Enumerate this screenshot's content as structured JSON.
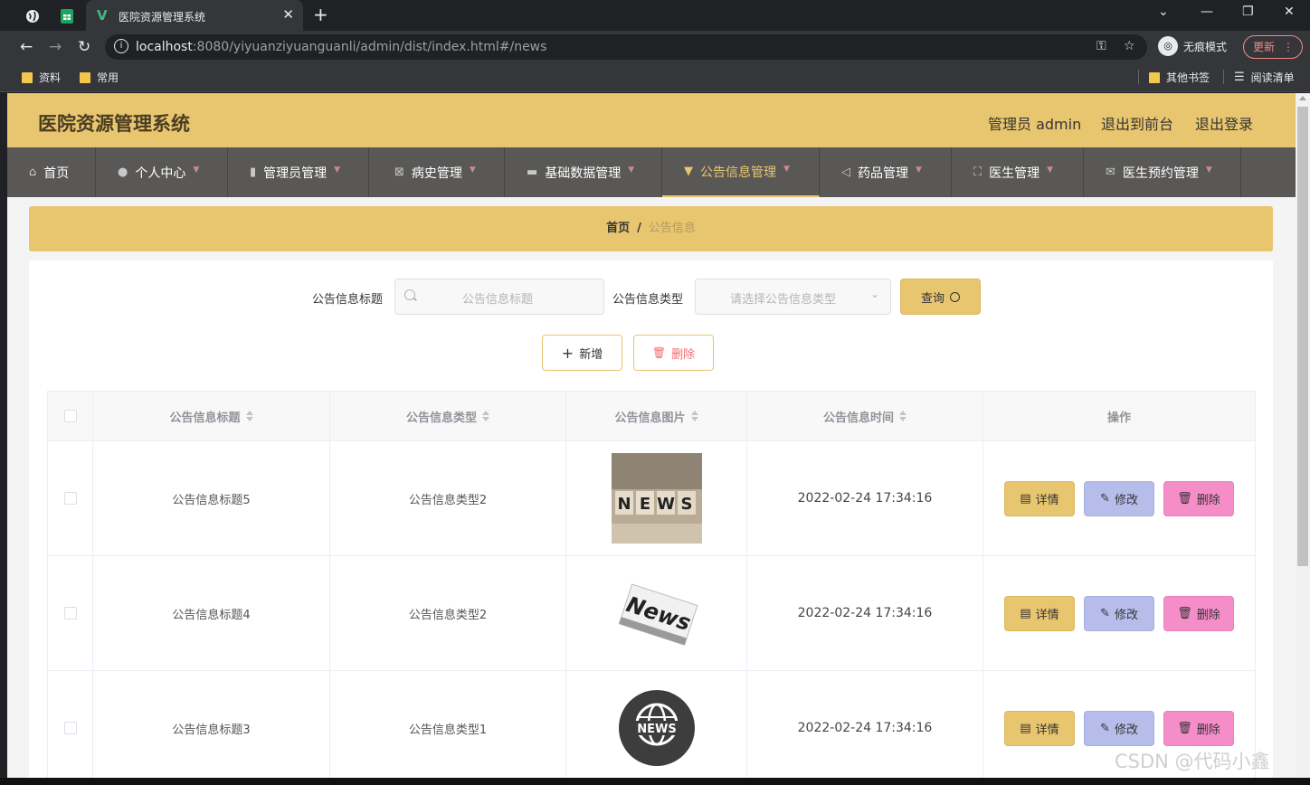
{
  "browser": {
    "tab_title": "医院资源管理系统",
    "url_host": "localhost",
    "url_rest": ":8080/yiyuanziyuanguanli/admin/dist/index.html#/news",
    "incognito_label": "无痕模式",
    "update_label": "更新",
    "bookmarks": [
      "资料",
      "常用"
    ],
    "other_bookmarks": "其他书签",
    "reading_list": "阅读清单"
  },
  "header": {
    "title": "医院资源管理系统",
    "user": "管理员 admin",
    "to_front": "退出到前台",
    "logout": "退出登录"
  },
  "menu": [
    {
      "label": "首页",
      "icon": "home-icon",
      "glyph": "⌂"
    },
    {
      "label": "个人中心",
      "icon": "user-icon",
      "glyph": "●"
    },
    {
      "label": "管理员管理",
      "icon": "book-icon",
      "glyph": "▮"
    },
    {
      "label": "病史管理",
      "icon": "clipboard-icon",
      "glyph": "⊠"
    },
    {
      "label": "基础数据管理",
      "icon": "monitor-icon",
      "glyph": "▬"
    },
    {
      "label": "公告信息管理",
      "icon": "brush-icon",
      "glyph": "▼"
    },
    {
      "label": "药品管理",
      "icon": "send-icon",
      "glyph": "◁"
    },
    {
      "label": "医生管理",
      "icon": "fullscreen-icon",
      "glyph": "⛶"
    },
    {
      "label": "医生预约管理",
      "icon": "mail-icon",
      "glyph": "✉"
    }
  ],
  "breadcrumb": {
    "home": "首页",
    "sep": "/",
    "current": "公告信息"
  },
  "search": {
    "title_label": "公告信息标题",
    "title_placeholder": "公告信息标题",
    "type_label": "公告信息类型",
    "type_placeholder": "请选择公告信息类型",
    "query_button": "查询"
  },
  "actions": {
    "add": "新增",
    "delete": "删除"
  },
  "table": {
    "headers": [
      "公告信息标题",
      "公告信息类型",
      "公告信息图片",
      "公告信息时间",
      "操作"
    ],
    "rows": [
      {
        "title": "公告信息标题5",
        "type": "公告信息类型2",
        "image": "news-blocks",
        "time": "2022-02-24 17:34:16"
      },
      {
        "title": "公告信息标题4",
        "type": "公告信息类型2",
        "image": "news-paper",
        "time": "2022-02-24 17:34:16"
      },
      {
        "title": "公告信息标题3",
        "type": "公告信息类型1",
        "image": "news-globe",
        "time": "2022-02-24 17:34:16"
      }
    ],
    "row_buttons": {
      "detail": "详情",
      "edit": "修改",
      "delete": "删除"
    }
  },
  "watermark": "CSDN @代码小鑫",
  "colors": {
    "accent": "#e8c56f",
    "menu_bg": "#595857",
    "edit": "#b6bdea",
    "delete": "#f58dc9"
  }
}
